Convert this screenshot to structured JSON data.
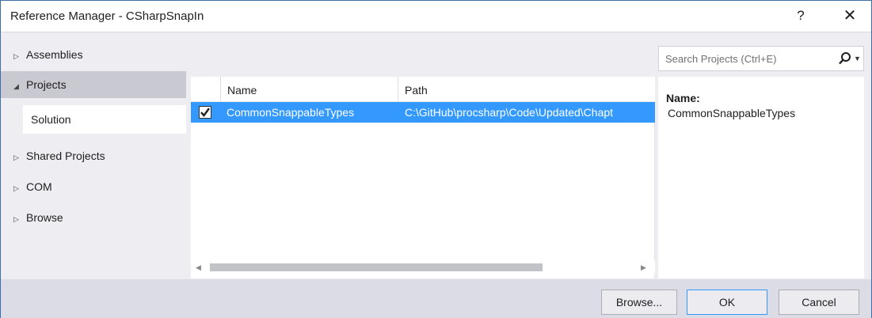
{
  "window": {
    "title": "Reference Manager - CSharpSnapIn",
    "help_glyph": "?",
    "close_glyph": "✕"
  },
  "nav": {
    "items": [
      {
        "label": "Assemblies",
        "expanded": false
      },
      {
        "label": "Projects",
        "expanded": true,
        "selected": true
      },
      {
        "label": "Shared Projects",
        "expanded": false
      },
      {
        "label": "COM",
        "expanded": false
      },
      {
        "label": "Browse",
        "expanded": false
      }
    ],
    "sub_items": [
      {
        "label": "Solution"
      }
    ],
    "collapsed_arrow": "▷",
    "expanded_arrow": "◢"
  },
  "search": {
    "placeholder": "Search Projects (Ctrl+E)",
    "value": ""
  },
  "grid": {
    "columns": [
      "",
      "Name",
      "Path"
    ],
    "rows": [
      {
        "checked": true,
        "name": "CommonSnappableTypes",
        "path": "C:\\GitHub\\procsharp\\Code\\Updated\\Chapt"
      }
    ],
    "selection_color": "#3399ff"
  },
  "detail": {
    "label": "Name:",
    "value": "CommonSnappableTypes"
  },
  "footer": {
    "browse_label": "Browse...",
    "ok_label": "OK",
    "cancel_label": "Cancel"
  },
  "colors": {
    "accent": "#3399ff",
    "nav_selected": "#c9c9d2",
    "footer": "#dcdce6"
  }
}
